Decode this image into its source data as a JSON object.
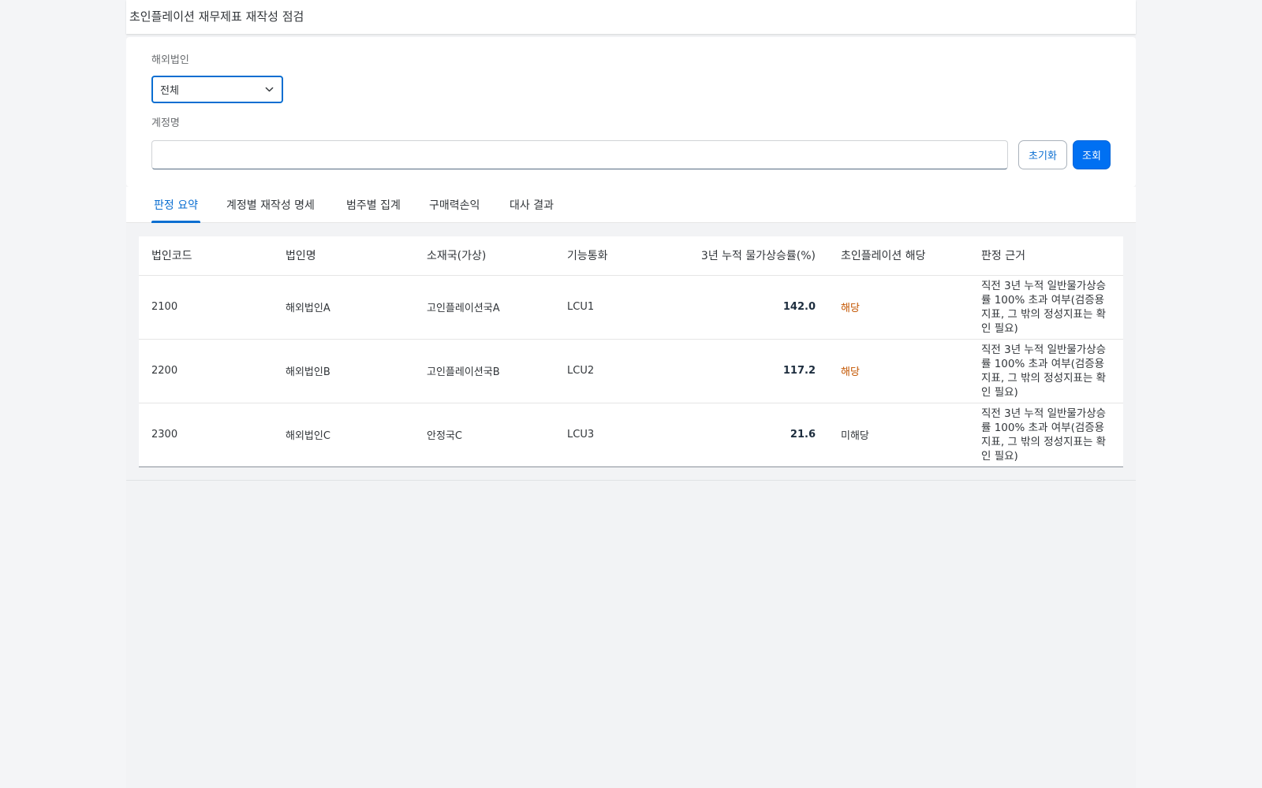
{
  "app": {
    "title": "초인플레이션 재무제표 재작성 점검"
  },
  "filters": {
    "entity_label": "해외법인",
    "entity_value": "전체",
    "account_label": "계정명",
    "account_value": "",
    "account_placeholder": "",
    "reset_label": "초기화",
    "search_label": "조회"
  },
  "tabs": [
    {
      "label": "판정 요약",
      "active": true
    },
    {
      "label": "계정별 재작성 명세",
      "active": false
    },
    {
      "label": "범주별 집계",
      "active": false
    },
    {
      "label": "구매력손익",
      "active": false
    },
    {
      "label": "대사 결과",
      "active": false
    }
  ],
  "table": {
    "headers": [
      "법인코드",
      "법인명",
      "소재국(가상)",
      "기능통화",
      "3년 누적 물가상승률(%)",
      "초인플레이션 해당",
      "판정 근거"
    ],
    "rows": [
      {
        "code": "2100",
        "name": "해외법인A",
        "country": "고인플레이션국A",
        "currency": "LCU1",
        "rate": "142.0",
        "status": "해당",
        "hit": true,
        "basis": "직전 3년 누적 일반물가상승률 100% 초과 여부(검증용 지표, 그 밖의 정성지표는 확인 필요)"
      },
      {
        "code": "2200",
        "name": "해외법인B",
        "country": "고인플레이션국B",
        "currency": "LCU2",
        "rate": "117.2",
        "status": "해당",
        "hit": true,
        "basis": "직전 3년 누적 일반물가상승률 100% 초과 여부(검증용 지표, 그 밖의 정성지표는 확인 필요)"
      },
      {
        "code": "2300",
        "name": "해외법인C",
        "country": "안정국C",
        "currency": "LCU3",
        "rate": "21.6",
        "status": "미해당",
        "hit": false,
        "basis": "직전 3년 누적 일반물가상승률 100% 초과 여부(검증용 지표, 그 밖의 정성지표는 확인 필요)"
      }
    ]
  },
  "colors": {
    "accent": "#0a6ed1",
    "primary_button": "#0070f2",
    "status_hit": "#c35500"
  },
  "icons": {
    "select_chevron": "chevron-down-icon"
  }
}
